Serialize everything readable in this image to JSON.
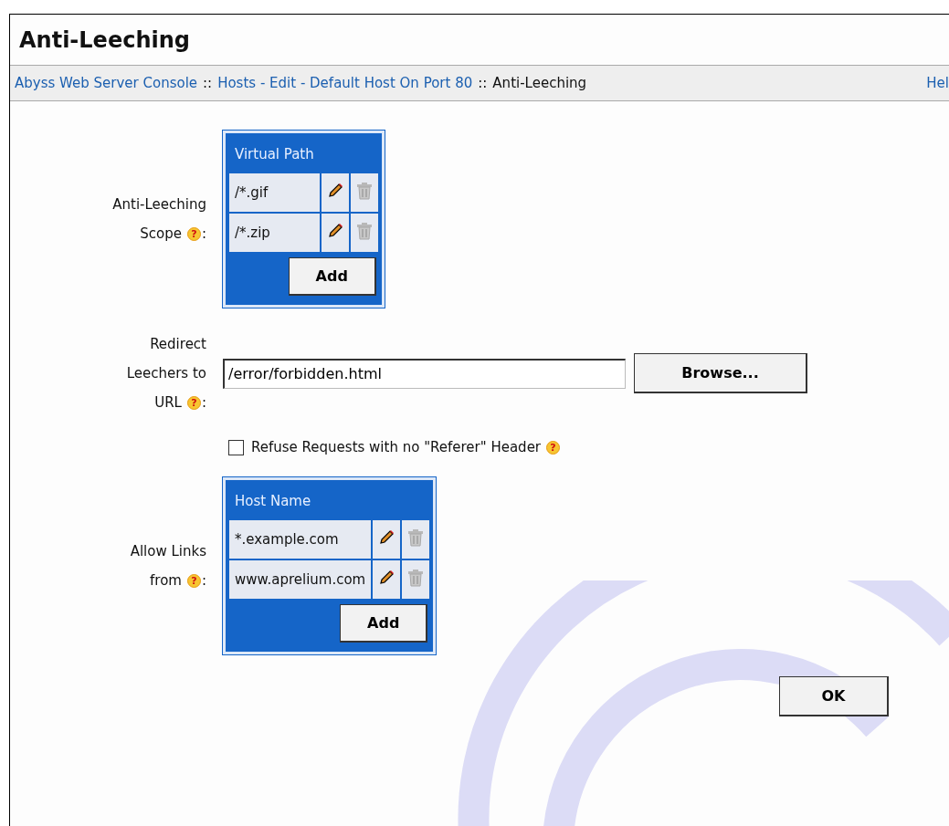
{
  "window": {
    "title": "Anti-Leeching"
  },
  "breadcrumb": [
    {
      "kind": "link",
      "text": "Abyss Web Server Console"
    },
    {
      "kind": "separator",
      "text": "::"
    },
    {
      "kind": "link",
      "text": "Hosts - Edit - Default Host On Port 80"
    },
    {
      "kind": "separator",
      "text": "::"
    },
    {
      "kind": "current",
      "text": "Anti-Leeching"
    }
  ],
  "help_link": "Hel",
  "fields": [
    {
      "kind": "table",
      "label_lines": [
        "Anti-Leeching",
        "Scope"
      ],
      "help": "?",
      "colon": ":",
      "column": "Virtual Path",
      "rows": [
        "/*.gif",
        "/*.zip"
      ],
      "button": "Add"
    },
    {
      "kind": "text",
      "label_lines": [
        "Redirect",
        "Leechers to",
        "URL"
      ],
      "help": "?",
      "colon": ":",
      "value": "/error/forbidden.html",
      "button": "Browse..."
    },
    {
      "kind": "checkbox",
      "label": "Refuse Requests with no \"Referer\" Header",
      "help": "?",
      "checked": false
    },
    {
      "kind": "table",
      "label_lines": [
        "Allow Links",
        "from"
      ],
      "help": "?",
      "colon": ":",
      "column": "Host Name",
      "rows": [
        "*.example.com",
        "www.aprelium.com"
      ],
      "button": "Add"
    }
  ],
  "ok_button": "OK"
}
